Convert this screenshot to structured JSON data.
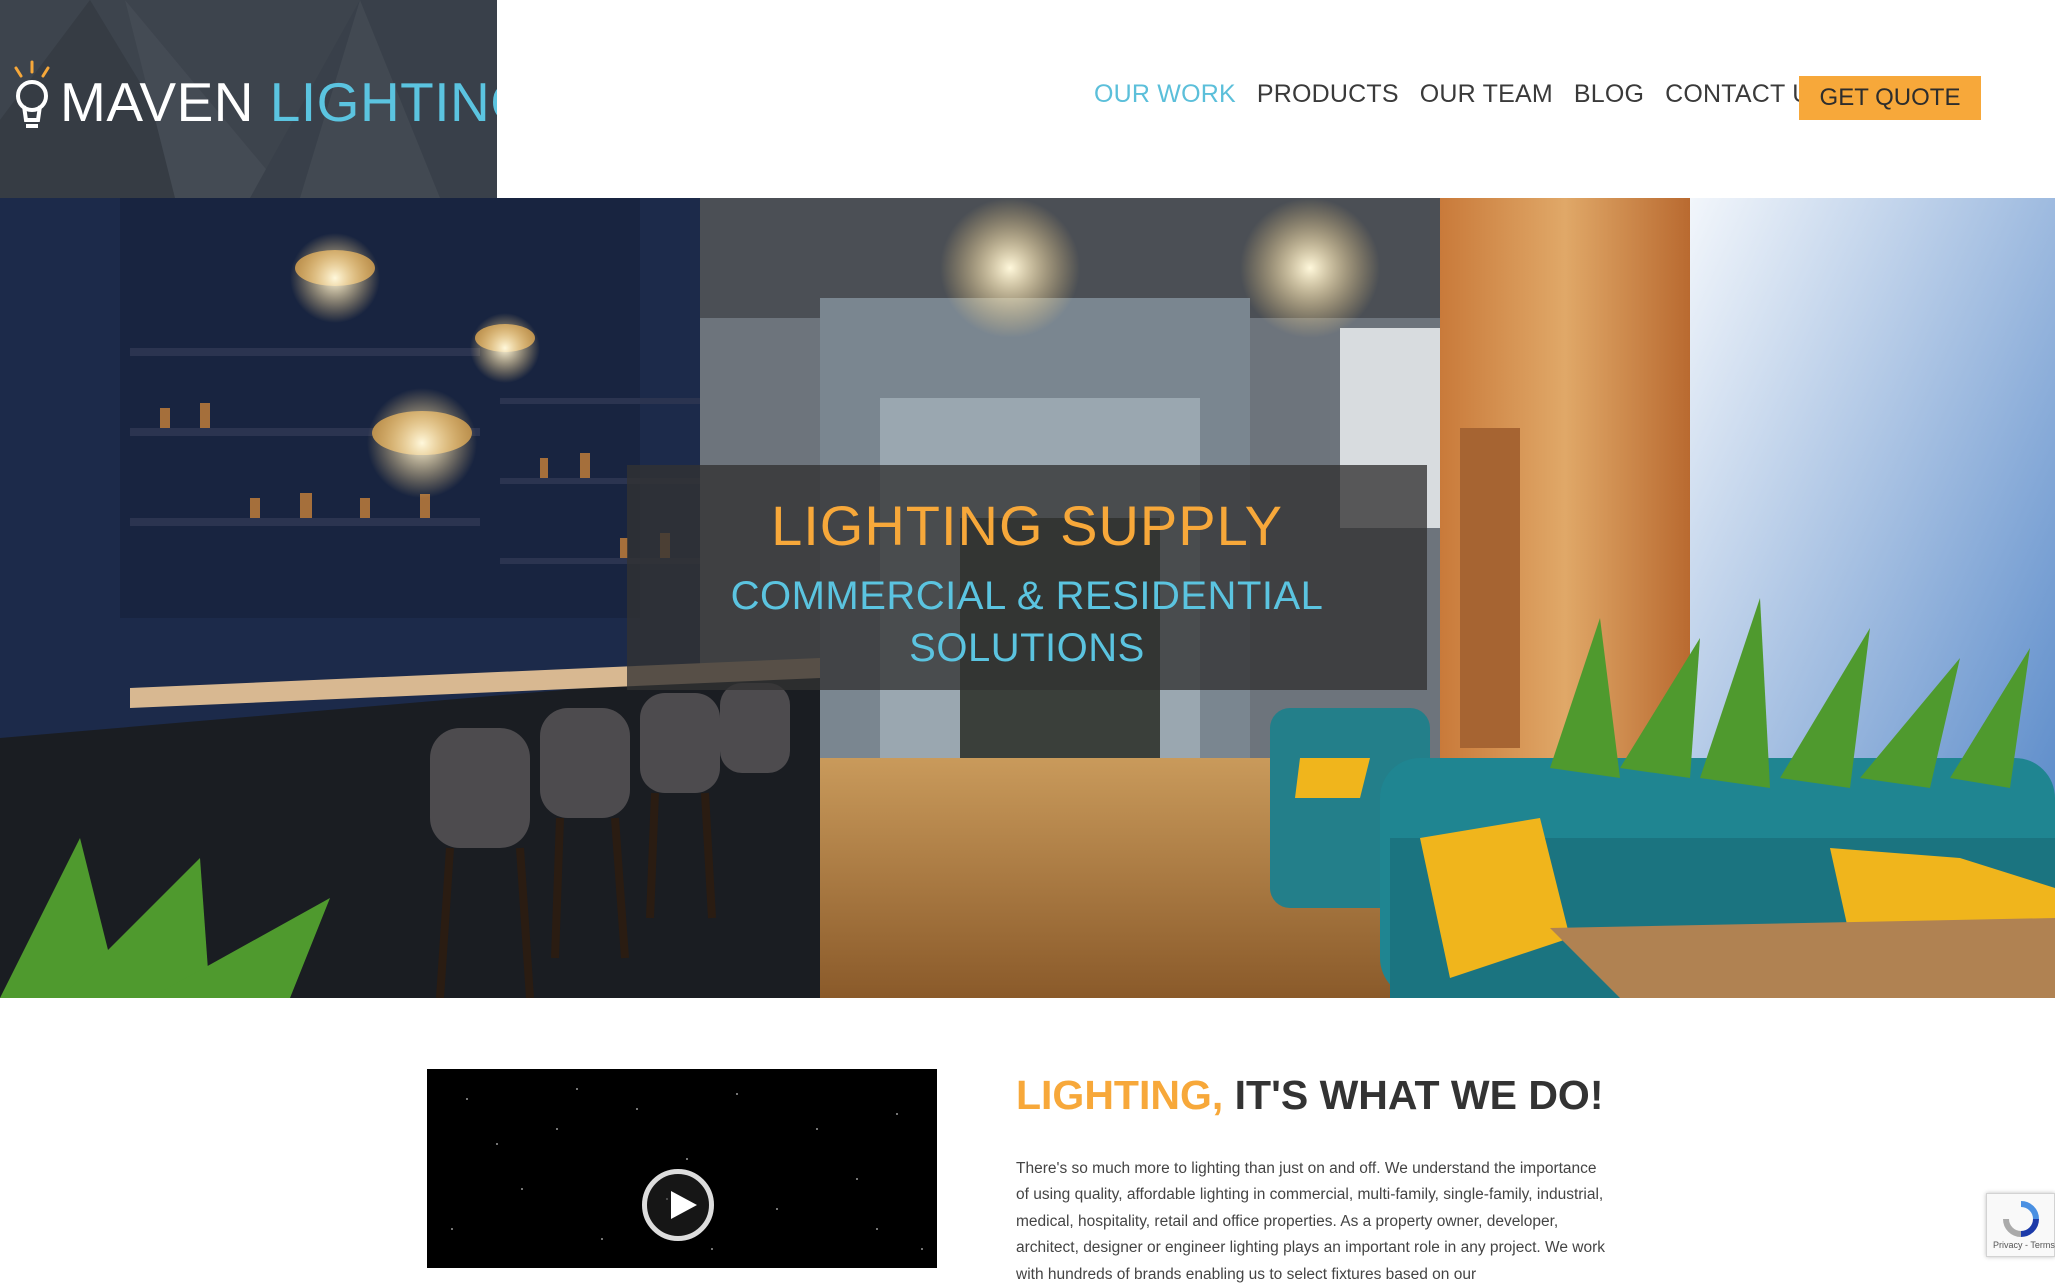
{
  "logo": {
    "word1": "MAVEN",
    "word2": "LIGHTING"
  },
  "nav": {
    "items": [
      {
        "label": "OUR WORK",
        "active": true
      },
      {
        "label": "PRODUCTS"
      },
      {
        "label": "OUR TEAM"
      },
      {
        "label": "BLOG"
      },
      {
        "label": "CONTACT US"
      }
    ],
    "cta": "GET QUOTE"
  },
  "hero": {
    "title": "LIGHTING SUPPLY",
    "subtitle": "COMMERCIAL & RESIDENTIAL SOLUTIONS"
  },
  "intro": {
    "heading_accent": "LIGHTING,",
    "heading_rest": " IT'S WHAT WE DO!",
    "body": "There's so much more to lighting than just on and off. We understand the importance of using quality, affordable lighting in commercial, multi-family, single-family, industrial, medical, hospitality, retail and office properties. As a property owner, developer, architect, designer or engineer lighting plays an important role in any project. We work with hundreds of brands enabling us to select fixtures based on our"
  },
  "recaptcha": {
    "links": "Privacy - Terms"
  },
  "colors": {
    "accent_orange": "#f7a83a",
    "accent_blue": "#5bc4e0",
    "logo_bg": "#3d444d"
  }
}
